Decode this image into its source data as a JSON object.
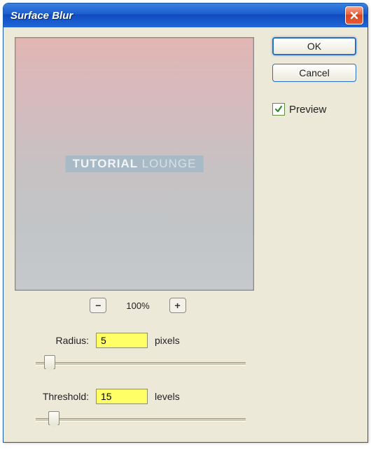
{
  "window": {
    "title": "Surface Blur"
  },
  "buttons": {
    "ok": "OK",
    "cancel": "Cancel"
  },
  "preview": {
    "label": "Preview",
    "checked": true
  },
  "zoom": {
    "level": "100%"
  },
  "params": {
    "radius": {
      "label": "Radius:",
      "value": "5",
      "unit": "pixels",
      "slider_pos_pct": 4
    },
    "threshold": {
      "label": "Threshold:",
      "value": "15",
      "unit": "levels",
      "slider_pos_pct": 6
    }
  },
  "watermark": {
    "strong": "TUTORIAL",
    "light": "LOUNGE"
  }
}
